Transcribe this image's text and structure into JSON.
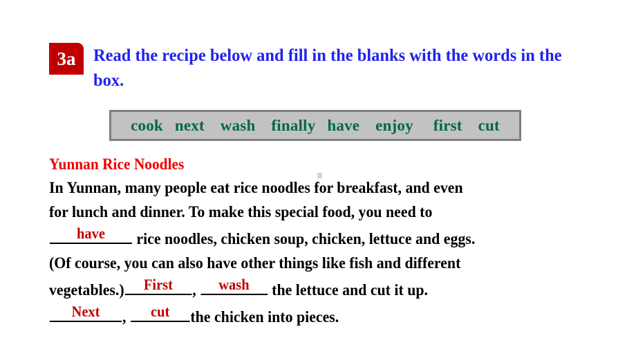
{
  "slide": {
    "background": "#ffffff",
    "task_badge": {
      "label": "3a",
      "background": "#c00000",
      "text_color": "#ffffff"
    },
    "instruction": {
      "text": "Read the recipe below and fill in the blanks with the words in the box.",
      "color": "#2222ee"
    }
  },
  "word_bank": {
    "background": "#c2c2c2",
    "border_color": "#7f7f7f",
    "text_color": "#00684a",
    "words": [
      "cook",
      "next",
      "wash",
      "finally",
      "have",
      "enjoy",
      "first",
      "cut"
    ]
  },
  "recipe": {
    "title": "Yunnan Rice Noodles",
    "title_color": "#ee0000",
    "answer_color": "#c00000",
    "body_color": "#000000",
    "line1": "In Yunnan, many people eat rice noodles for breakfast, and even",
    "line2": "for lunch and dinner. To make this special food, you need to",
    "line3_answer": "have",
    "line3_after": " rice noodles, chicken soup, chicken, lettuce and eggs.",
    "line4": "(Of course, you can also have other things like fish and different",
    "line5_before": "vegetables.)",
    "line5_answer1": "First",
    "line5_mid": ", ",
    "line5_answer2": "wash",
    "line5_after": " the lettuce and cut it up.",
    "line6_answer1": "Next",
    "line6_mid": ", ",
    "line6_answer2": "cut",
    "line6_after": "the chicken into pieces."
  }
}
